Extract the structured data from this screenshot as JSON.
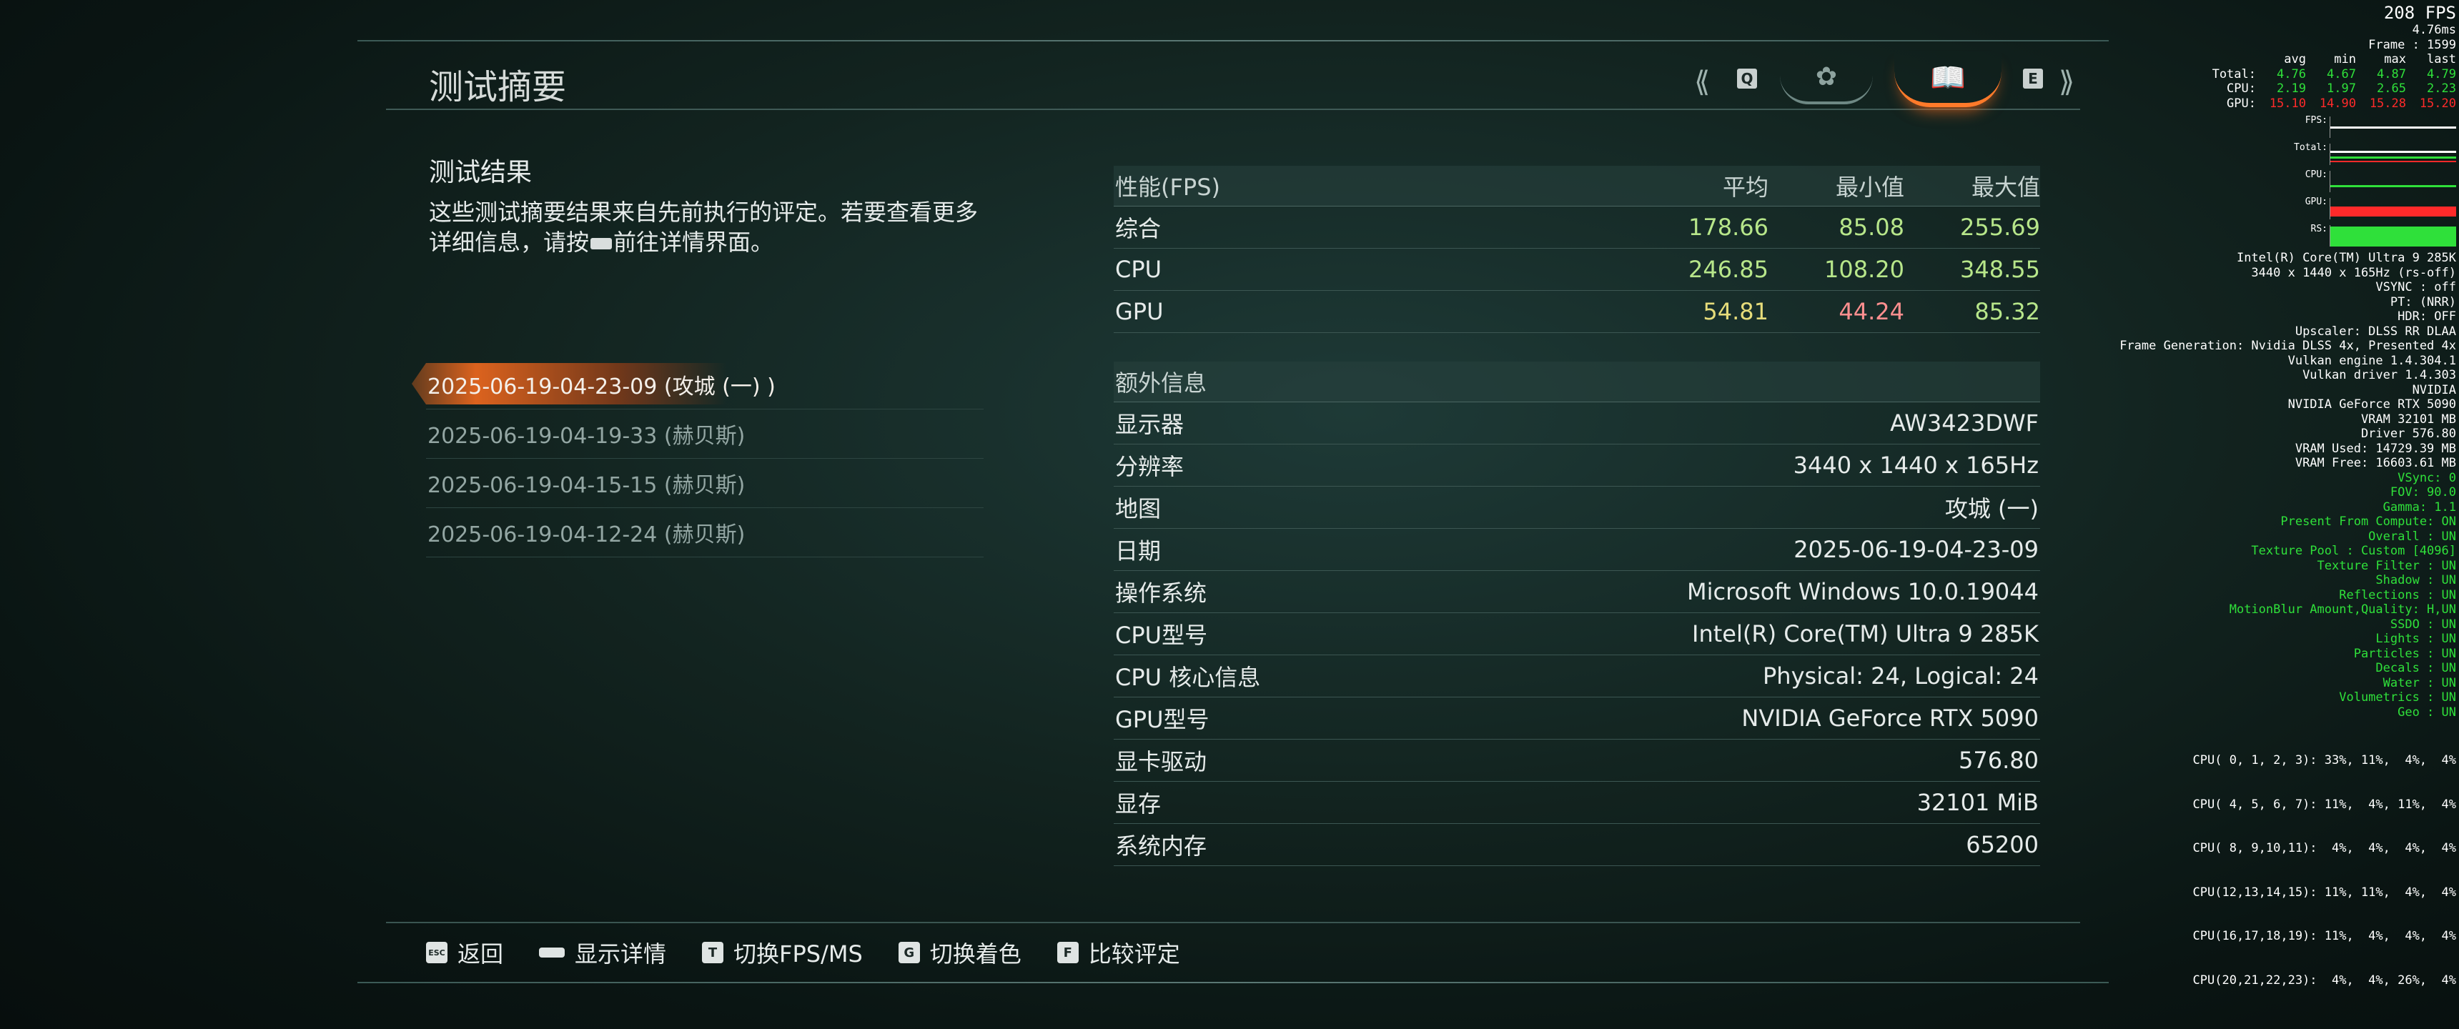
{
  "page_title": "测试摘要",
  "top_controls": {
    "left_key": "Q",
    "right_key": "E",
    "tab1_icon": "swirl-icon",
    "tab2_icon": "book-icon"
  },
  "section_heading": "测试结果",
  "description_part1": "这些测试摘要结果来自先前执行的评定。若要查看更多详细信息，请按",
  "description_part2": "前往详情界面。",
  "runs": [
    {
      "label": "2025-06-19-04-23-09 (攻城 (一) )",
      "active": true
    },
    {
      "label": "2025-06-19-04-19-33 (赫贝斯)",
      "active": false
    },
    {
      "label": "2025-06-19-04-15-15 (赫贝斯)",
      "active": false
    },
    {
      "label": "2025-06-19-04-12-24 (赫贝斯)",
      "active": false
    }
  ],
  "perf_table": {
    "headers": [
      "性能(FPS)",
      "平均",
      "最小值",
      "最大值"
    ],
    "rows": [
      {
        "label": "综合",
        "avg": "178.66",
        "min": "85.08",
        "max": "255.69"
      },
      {
        "label": "CPU",
        "avg": "246.85",
        "min": "108.20",
        "max": "348.55"
      },
      {
        "label": "GPU",
        "avg": "54.81",
        "min": "44.24",
        "max": "85.32"
      }
    ]
  },
  "extra_table": {
    "header": "额外信息",
    "rows": [
      {
        "label": "显示器",
        "value": "AW3423DWF"
      },
      {
        "label": "分辨率",
        "value": "3440 x 1440 x 165Hz"
      },
      {
        "label": "地图",
        "value": "攻城 (一) "
      },
      {
        "label": "日期",
        "value": "2025-06-19-04-23-09"
      },
      {
        "label": "操作系统",
        "value": "Microsoft Windows 10.0.19044"
      },
      {
        "label": "CPU型号",
        "value": "Intel(R) Core(TM) Ultra 9 285K"
      },
      {
        "label": "CPU 核心信息",
        "value": "Physical: 24, Logical: 24"
      },
      {
        "label": "GPU型号",
        "value": "NVIDIA GeForce RTX 5090"
      },
      {
        "label": "显卡驱动",
        "value": "576.80"
      },
      {
        "label": "显存",
        "value": "32101 MiB"
      },
      {
        "label": "系统内存",
        "value": "65200"
      }
    ]
  },
  "hints": [
    {
      "key": "ESC",
      "label": "返回"
    },
    {
      "key": "",
      "label": "显示详情"
    },
    {
      "key": "T",
      "label": "切换FPS/MS"
    },
    {
      "key": "G",
      "label": "切换着色"
    },
    {
      "key": "F",
      "label": "比较评定"
    }
  ],
  "overlay": {
    "fps": "208 FPS",
    "ms": "4.76ms",
    "frame": "Frame : 1599",
    "stats_header": [
      "",
      "avg",
      "min",
      "max",
      "last"
    ],
    "stats": [
      {
        "label": "Total:",
        "values": [
          "4.76",
          "4.67",
          "4.87",
          "4.79"
        ],
        "color": "green"
      },
      {
        "label": "CPU:",
        "values": [
          "2.19",
          "1.97",
          "2.65",
          "2.23"
        ],
        "color": "green"
      },
      {
        "label": "GPU:",
        "values": [
          "15.10",
          "14.90",
          "15.28",
          "15.20"
        ],
        "color": "red"
      }
    ],
    "graph_labels": [
      "FPS:",
      "Total:",
      "CPU:",
      "GPU:",
      "RS:"
    ],
    "info_white": [
      "Intel(R) Core(TM) Ultra 9 285K",
      "3440 x 1440 x 165Hz (rs-off)",
      "VSYNC : off",
      "PT: (NRR)",
      "HDR: OFF",
      "Upscaler: DLSS RR DLAA",
      "Frame Generation: Nvidia DLSS 4x, Presented 4x",
      "Vulkan engine 1.4.304.1",
      "Vulkan driver 1.4.303",
      "NVIDIA",
      "NVIDIA GeForce RTX 5090",
      "VRAM 32101 MB",
      "Driver 576.80",
      "VRAM Used: 14729.39 MB",
      "VRAM Free: 16603.61 MB"
    ],
    "info_green": [
      "VSync: 0",
      "FOV: 90.0",
      "Gamma: 1.1",
      "Present From Compute: ON",
      "Overall : UN",
      "Texture Pool : Custom [4096]",
      "Texture Filter : UN",
      "Shadow : UN",
      "Reflections : UN",
      "MotionBlur Amount,Quality: H,UN",
      "SSDO : UN",
      "Lights : UN",
      "Particles : UN",
      "Decals : UN",
      "Water : UN",
      "Volumetrics : UN",
      "Geo : UN"
    ],
    "cpu_lines": [
      "CPU( 0, 1, 2, 3): 33%, 11%,  4%,  4%",
      "CPU( 4, 5, 6, 7): 11%,  4%, 11%,  4%",
      "CPU( 8, 9,10,11):  4%,  4%,  4%,  4%",
      "CPU(12,13,14,15): 11%, 11%,  4%,  4%",
      "CPU(16,17,18,19): 11%,  4%,  4%,  4%",
      "CPU(20,21,22,23):  4%,  4%, 26%,  4%"
    ]
  },
  "colors": {
    "accent": "#ff7a2a",
    "value_green": "#b7e68a",
    "value_yellow": "#e6dc7a",
    "value_red": "#ff8f8f",
    "overlay_green": "#2fe03a",
    "overlay_red": "#ff2a2a"
  }
}
